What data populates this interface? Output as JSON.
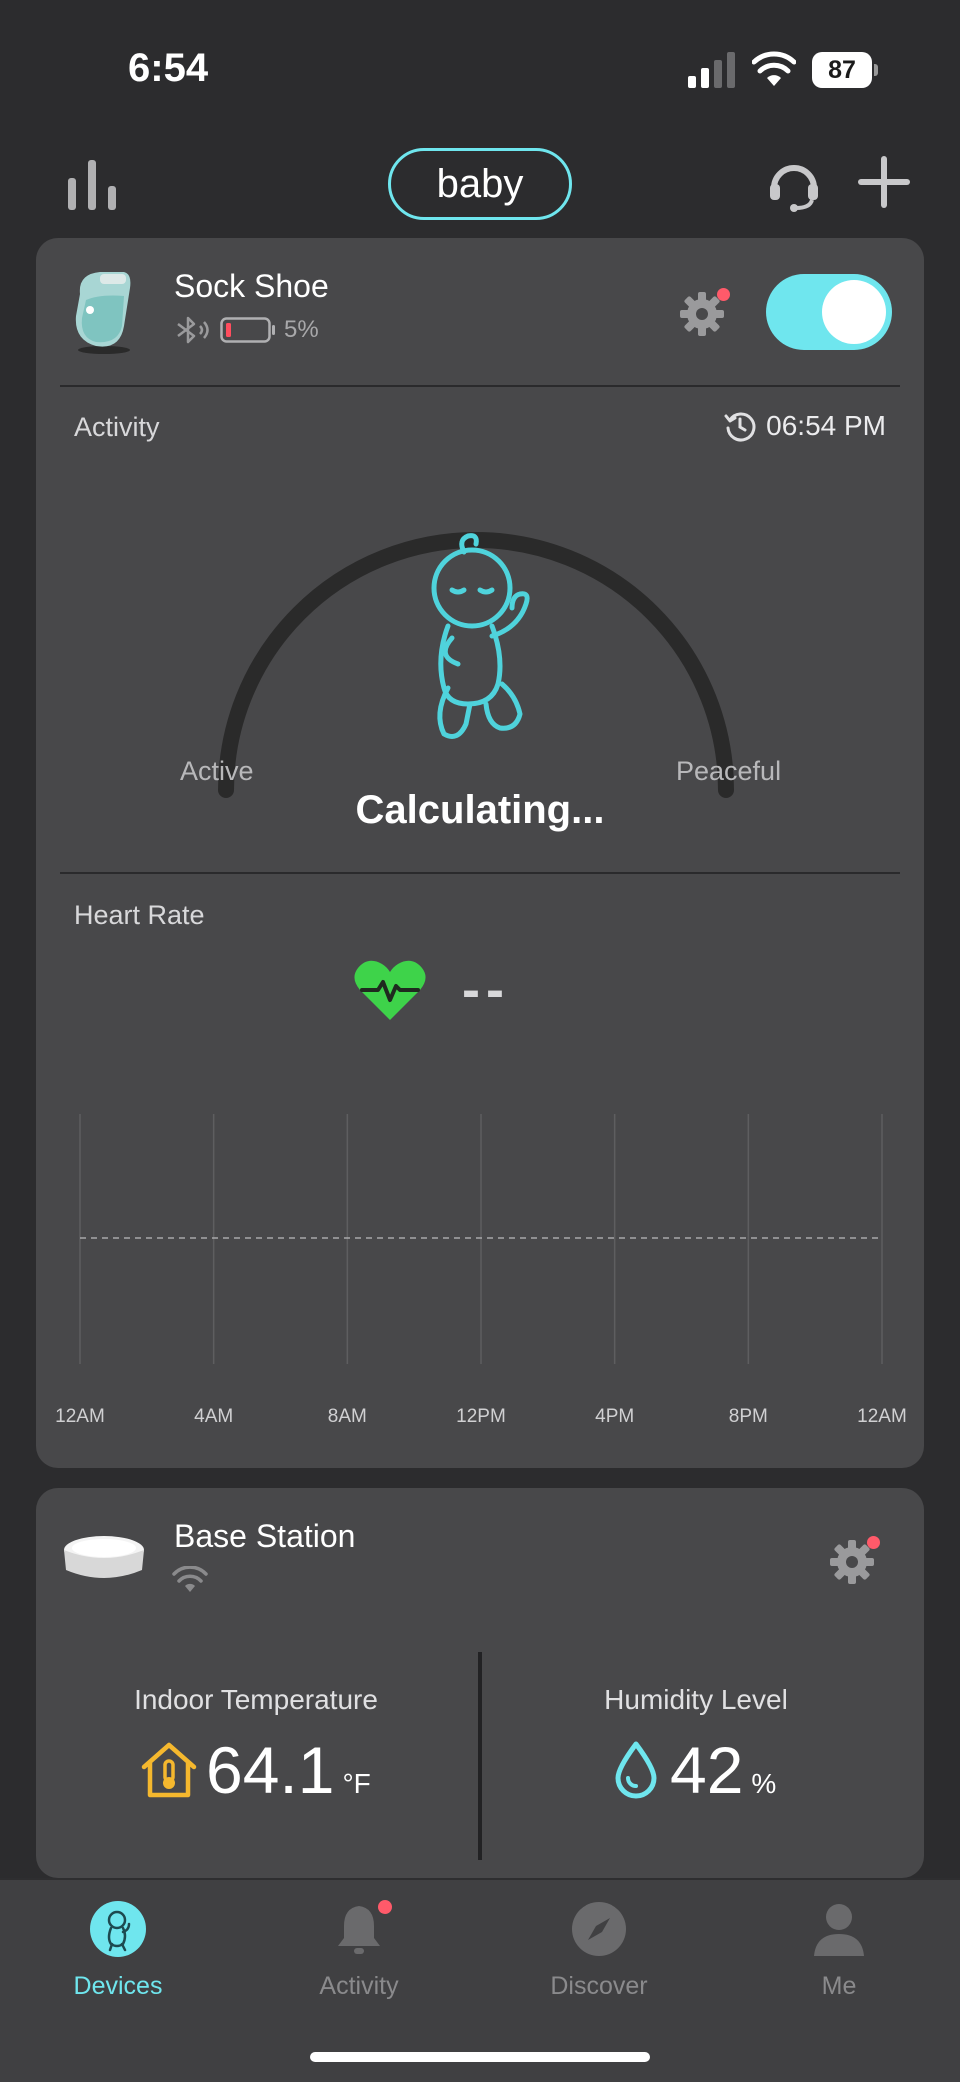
{
  "status_bar": {
    "time": "6:54",
    "battery_level": "87"
  },
  "header": {
    "profile_name": "baby"
  },
  "sock_card": {
    "device_name": "Sock Shoe",
    "battery_percent": "5%",
    "toggle_on": true,
    "activity": {
      "label": "Activity",
      "updated_time": "06:54 PM",
      "left_label": "Active",
      "right_label": "Peaceful",
      "status": "Calculating..."
    },
    "heart_rate": {
      "label": "Heart Rate",
      "value": "--",
      "x_ticks": [
        "12AM",
        "4AM",
        "8AM",
        "12PM",
        "4PM",
        "8PM",
        "12AM"
      ]
    }
  },
  "base_card": {
    "device_name": "Base Station",
    "temperature": {
      "label": "Indoor Temperature",
      "value": "64.1",
      "unit": "°F"
    },
    "humidity": {
      "label": "Humidity Level",
      "value": "42",
      "unit": "%"
    }
  },
  "tabs": [
    {
      "label": "Devices",
      "active": true
    },
    {
      "label": "Activity",
      "active": false,
      "badge": true
    },
    {
      "label": "Discover",
      "active": false
    },
    {
      "label": "Me",
      "active": false
    }
  ],
  "colors": {
    "accent": "#6fe6ee",
    "heart": "#3ed34a",
    "alert": "#ff5a6a",
    "temp_icon": "#f5b82e",
    "card": "#48484a",
    "background": "#2c2c2e"
  }
}
